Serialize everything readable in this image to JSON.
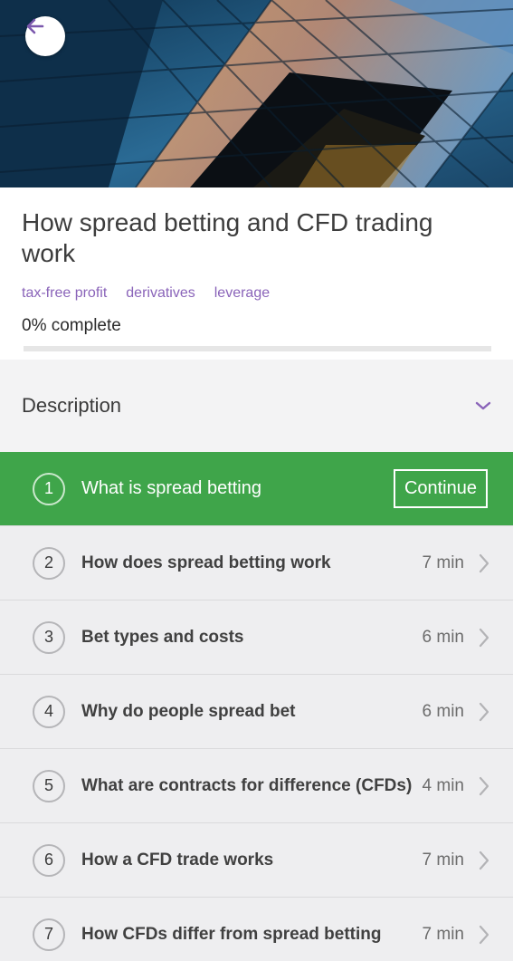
{
  "hero": {
    "image": "glass-building-photo",
    "back_icon": "arrow-left-icon"
  },
  "course": {
    "title": "How spread betting and CFD trading work",
    "tags": [
      "tax-free profit",
      "derivatives",
      "leverage"
    ],
    "progress_label": "0% complete",
    "progress_percent": 0
  },
  "description": {
    "label": "Description",
    "icon": "chevron-down-icon"
  },
  "lessons": [
    {
      "number": "1",
      "title": "What is spread betting",
      "action": "Continue",
      "active": true
    },
    {
      "number": "2",
      "title": "How does spread betting work",
      "duration": "7 min"
    },
    {
      "number": "3",
      "title": "Bet types and costs",
      "duration": "6 min"
    },
    {
      "number": "4",
      "title": "Why do people spread bet",
      "duration": "6 min"
    },
    {
      "number": "5",
      "title": "What are contracts for difference (CFDs)",
      "duration": "4 min"
    },
    {
      "number": "6",
      "title": "How a CFD trade works",
      "duration": "7 min"
    },
    {
      "number": "7",
      "title": "How CFDs differ from spread betting",
      "duration": "7 min"
    }
  ],
  "colors": {
    "accent": "#8a64b9",
    "active_row": "#3fa54a",
    "row_background": "#eeeef0"
  }
}
